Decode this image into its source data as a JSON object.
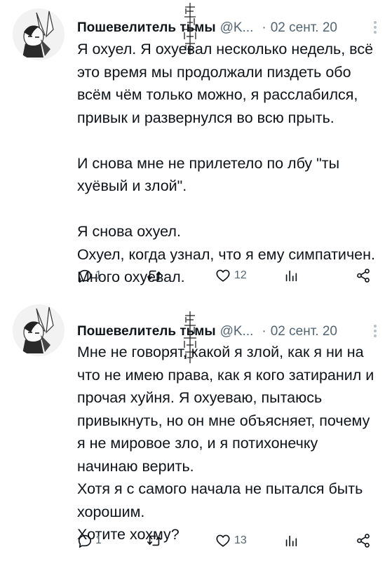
{
  "tweets": [
    {
      "author": "Пошевелитель тьмы",
      "handle": "@K...",
      "dot": "·",
      "date": "02 сент. 20",
      "text": "Я охуел. Я охуевал несколько недель, всё это время мы продолжали пиздеть обо всём чём только можно, я расслабился, привык и развернулся во всю прыть.\n\nИ снова мне не прилетело по лбу \"ты хуёвый и злой\".\n\nЯ снова охуел.\nОхуел, когда узнал, что я ему симпатичен.\nМного охуевал.",
      "replies": "1",
      "retweets": "",
      "likes": "12"
    },
    {
      "author": "Пошевелитель тьмы",
      "handle": "@K...",
      "dot": "·",
      "date": "02 сент. 20",
      "text": "Мне не говорят, какой я злой, как я ни на что не имею права, как я кого затиранил и прочая хуйня. Я охуеваю, пытаюсь привыкнуть, но он мне объясняет, почему я не мировое зло, и я потихонечку начинаю верить.\nХотя я с самого начала не пытался быть хорошим.\nХотите хохму?",
      "replies": "1",
      "retweets": "",
      "likes": "13"
    }
  ],
  "icons": {
    "reply": "reply-icon",
    "retweet": "retweet-icon",
    "like": "heart-icon",
    "views": "analytics-icon",
    "share": "share-icon",
    "more": "more-icon"
  },
  "colors": {
    "text": "#0f1419",
    "secondary": "#536471",
    "background": "#ffffff"
  }
}
